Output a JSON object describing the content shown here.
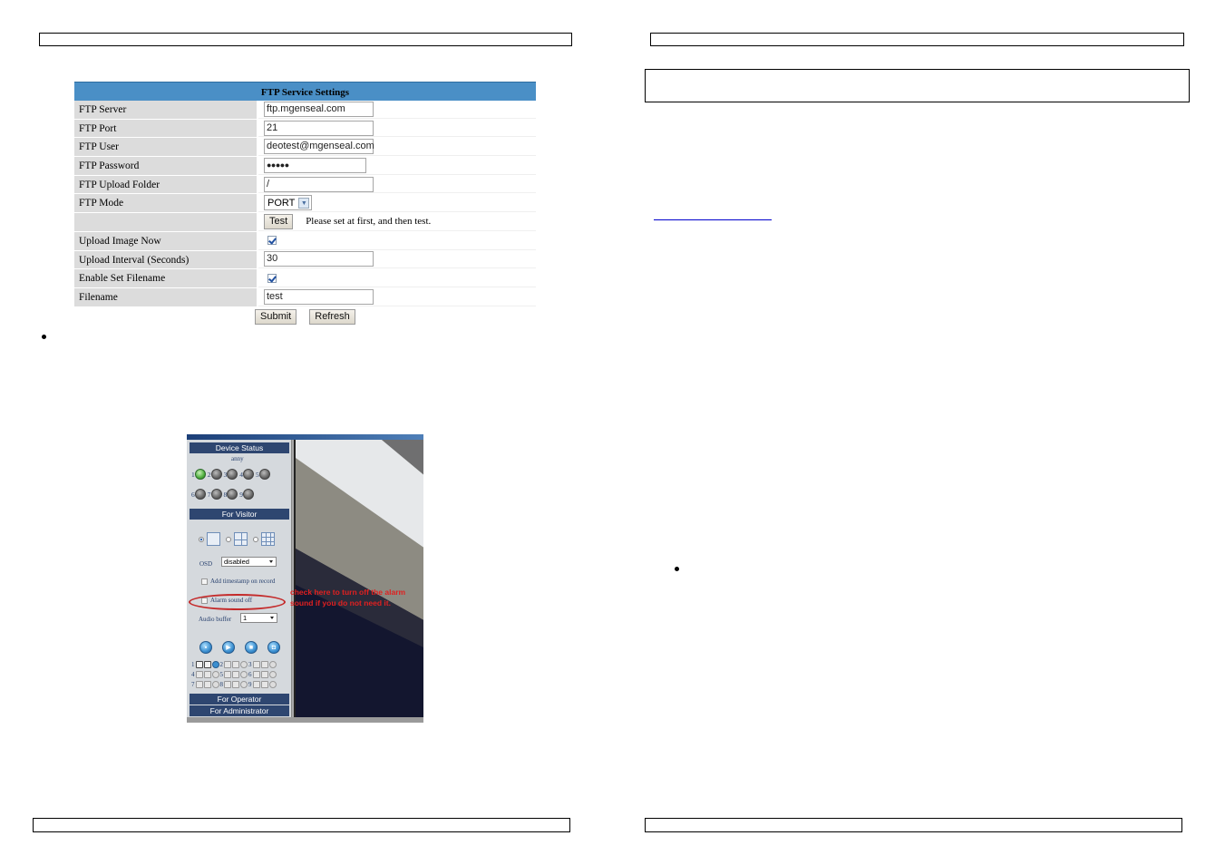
{
  "ftp_settings": {
    "title": "FTP Service Settings",
    "rows": [
      {
        "label": "FTP Server",
        "value": "ftp.mgenseal.com"
      },
      {
        "label": "FTP Port",
        "value": "21"
      },
      {
        "label": "FTP User",
        "value": "deotest@mgenseal.com"
      },
      {
        "label": "FTP Password",
        "value": "●●●●●"
      },
      {
        "label": "FTP Upload Folder",
        "value": "/"
      },
      {
        "label": "FTP Mode",
        "value": "PORT"
      },
      {
        "label": "",
        "button": "Test",
        "note": "Please set at first, and then test."
      },
      {
        "label": "Upload Image Now",
        "checked": true
      },
      {
        "label": "Upload Interval (Seconds)",
        "value": "30"
      },
      {
        "label": "Enable Set Filename",
        "checked": true
      },
      {
        "label": "Filename",
        "value": "test"
      }
    ],
    "submit_label": "Submit",
    "refresh_label": "Refresh"
  },
  "camera_ui": {
    "device_status_header": "Device Status",
    "device_name": "anny",
    "device_leds": [
      {
        "num": "1",
        "active": true
      },
      {
        "num": "2",
        "active": false
      },
      {
        "num": "3",
        "active": false
      },
      {
        "num": "4",
        "active": false
      },
      {
        "num": "5",
        "active": false
      },
      {
        "num": "6",
        "active": false
      },
      {
        "num": "7",
        "active": false
      },
      {
        "num": "8",
        "active": false
      },
      {
        "num": "9",
        "active": false
      }
    ],
    "for_visitor_header": "For Visitor",
    "osd_label": "OSD",
    "osd_value": "disabled",
    "add_timestamp_label": "Add timestamp on record",
    "add_timestamp_checked": false,
    "alarm_sound_off_label": "Alarm sound off",
    "alarm_sound_off_checked": false,
    "audio_buffer_label": "Audio buffer",
    "audio_buffer_value": "1",
    "control_buttons": [
      "folder-icon",
      "play-icon",
      "stop-icon",
      "camera-icon"
    ],
    "channels": [
      "1",
      "2",
      "3",
      "4",
      "5",
      "6",
      "7",
      "8",
      "9"
    ],
    "for_operator_header": "For Operator",
    "for_administrator_header": "For Administrator",
    "annotation": "check here to turn off the alarm sound if you do not need it.",
    "annotation_color": "#e02020"
  },
  "colors": {
    "table_header": "#4a8fc6",
    "label_bg": "#dcdcdc",
    "panel_header": "#2e4670",
    "link": "#0000cc"
  }
}
